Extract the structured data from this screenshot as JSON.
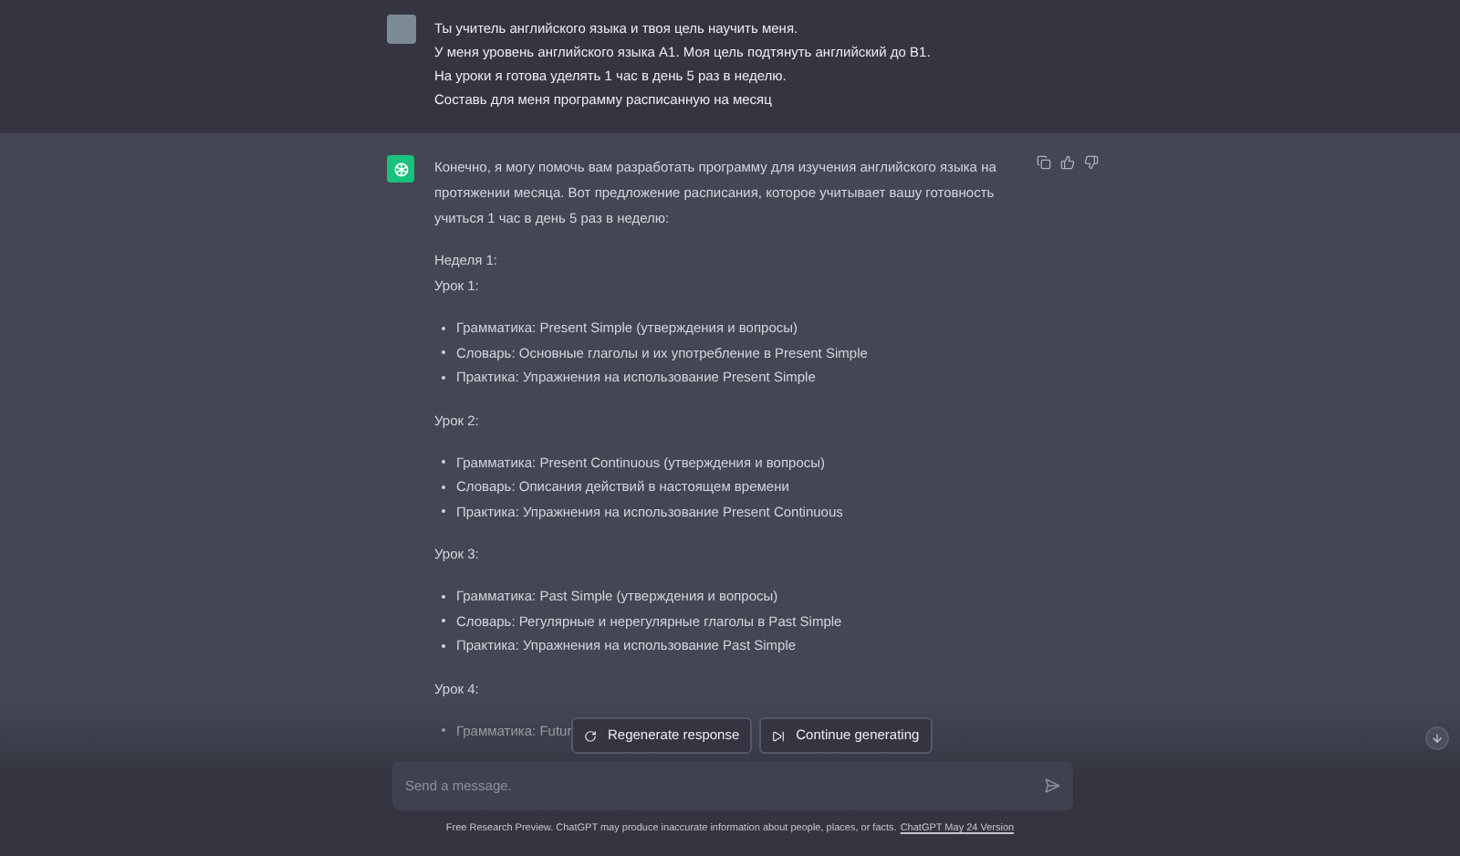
{
  "user_message": {
    "lines": [
      "Ты учитель английского языка и твоя цель научить меня.",
      "У меня уровень английского языка A1. Моя цель подтянуть английский до B1.",
      "На уроки я готова уделять 1 час в день 5 раз в неделю.",
      "Составь для меня программу расписанную на месяц"
    ]
  },
  "assistant_message": {
    "intro": "Конечно, я могу помочь вам разработать программу для изучения английского языка на протяжении месяца. Вот предложение расписания, которое учитывает вашу готовность учиться 1 час в день 5 раз в неделю:",
    "week": "Неделя 1:",
    "lessons": [
      {
        "title": "Урок 1:",
        "bullets": [
          "Грамматика: Present Simple (утверждения и вопросы)",
          "Словарь: Основные глаголы и их употребление в Present Simple",
          "Практика: Упражнения на использование Present Simple"
        ]
      },
      {
        "title": "Урок 2:",
        "bullets": [
          "Грамматика: Present Continuous (утверждения и вопросы)",
          "Словарь: Описания действий в настоящем времени",
          "Практика: Упражнения на использование Present Continuous"
        ]
      },
      {
        "title": "Урок 3:",
        "bullets": [
          "Грамматика: Past Simple (утверждения и вопросы)",
          "Словарь: Регулярные и нерегулярные глаголы в Past Simple",
          "Практика: Упражнения на использование Past Simple"
        ]
      },
      {
        "title": "Урок 4:",
        "bullets": [
          "Грамматика: Futur"
        ]
      }
    ]
  },
  "overlay_buttons": [
    {
      "kind": "regenerate",
      "label": "Regenerate response"
    },
    {
      "kind": "continue",
      "label": "Continue generating"
    }
  ],
  "composer": {
    "placeholder": "Send a message."
  },
  "footer": {
    "text": "Free Research Preview. ChatGPT may produce inaccurate information about people, places, or facts.",
    "link": "ChatGPT May 24 Version"
  }
}
